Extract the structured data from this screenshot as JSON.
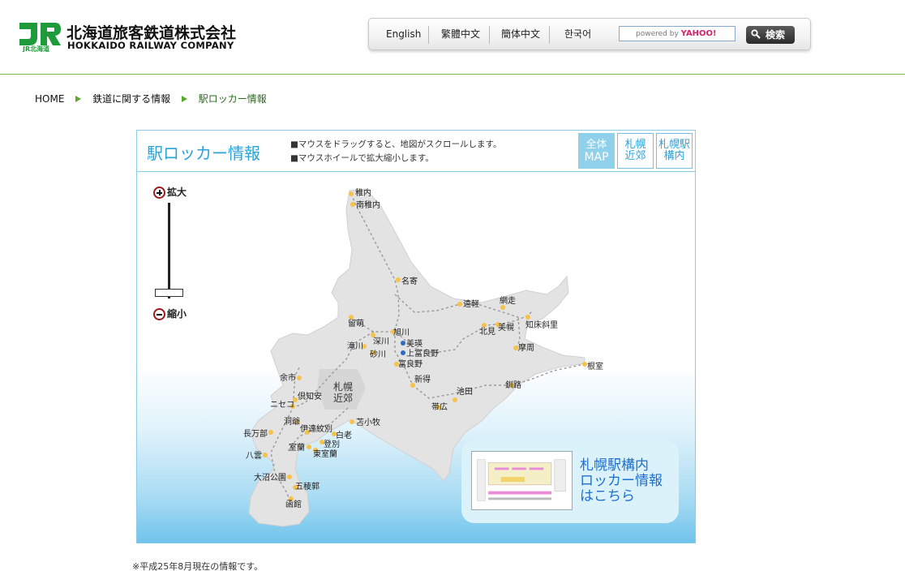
{
  "header": {
    "company_name_ja": "北海道旅客鉄道株式会社",
    "company_name_en": "HOKKAIDO RAILWAY COMPANY",
    "logo_text": "JR北海道",
    "languages": [
      "English",
      "繁體中文",
      "簡体中文",
      "한국어"
    ],
    "search_placeholder": "powered by",
    "search_brand": "YAHOO!",
    "search_button": "検索"
  },
  "breadcrumb": [
    "HOME",
    "鉄道に関する情報",
    "駅ロッカー情報"
  ],
  "panel": {
    "title": "駅ロッカー情報",
    "notes": [
      "■マウスをドラッグすると、地図がスクロールします。",
      "■マウスホイールで拡大縮小します。"
    ],
    "view_buttons": [
      {
        "line1": "全体",
        "line2": "MAP",
        "active": true
      },
      {
        "line1": "札幌",
        "line2": "近郊",
        "active": false
      },
      {
        "line1": "札幌駅",
        "line2": "構内",
        "active": false
      }
    ],
    "zoom_in": "拡大",
    "zoom_out": "縮小",
    "area_label": [
      "札幌",
      "近郊"
    ],
    "promo_lines": [
      "札幌駅構内",
      "ロッカー情報",
      "はこちら"
    ]
  },
  "stations": [
    "稚内",
    "南稚内",
    "名寄",
    "遠軽",
    "網走",
    "北見",
    "美幌",
    "知床斜里",
    "留萌",
    "旭川",
    "深川",
    "滝川",
    "砂川",
    "美瑛",
    "上富良野",
    "富良野",
    "摩周",
    "根室",
    "余市",
    "倶知安",
    "新得",
    "池田",
    "帯広",
    "釧路",
    "ニセコ",
    "洞爺",
    "伊達紋別",
    "苫小牧",
    "白老",
    "長万部",
    "室蘭",
    "登別",
    "東室蘭",
    "八雲",
    "大沼公園",
    "五稜郭",
    "函館"
  ],
  "footnote": "※平成25年8月現在の情報です。",
  "colors": {
    "accent_blue": "#2aa3dc",
    "green_rule": "#7cbf5a",
    "jr_green": "#1f9b3c",
    "promo_blue": "#1d6fd0"
  }
}
